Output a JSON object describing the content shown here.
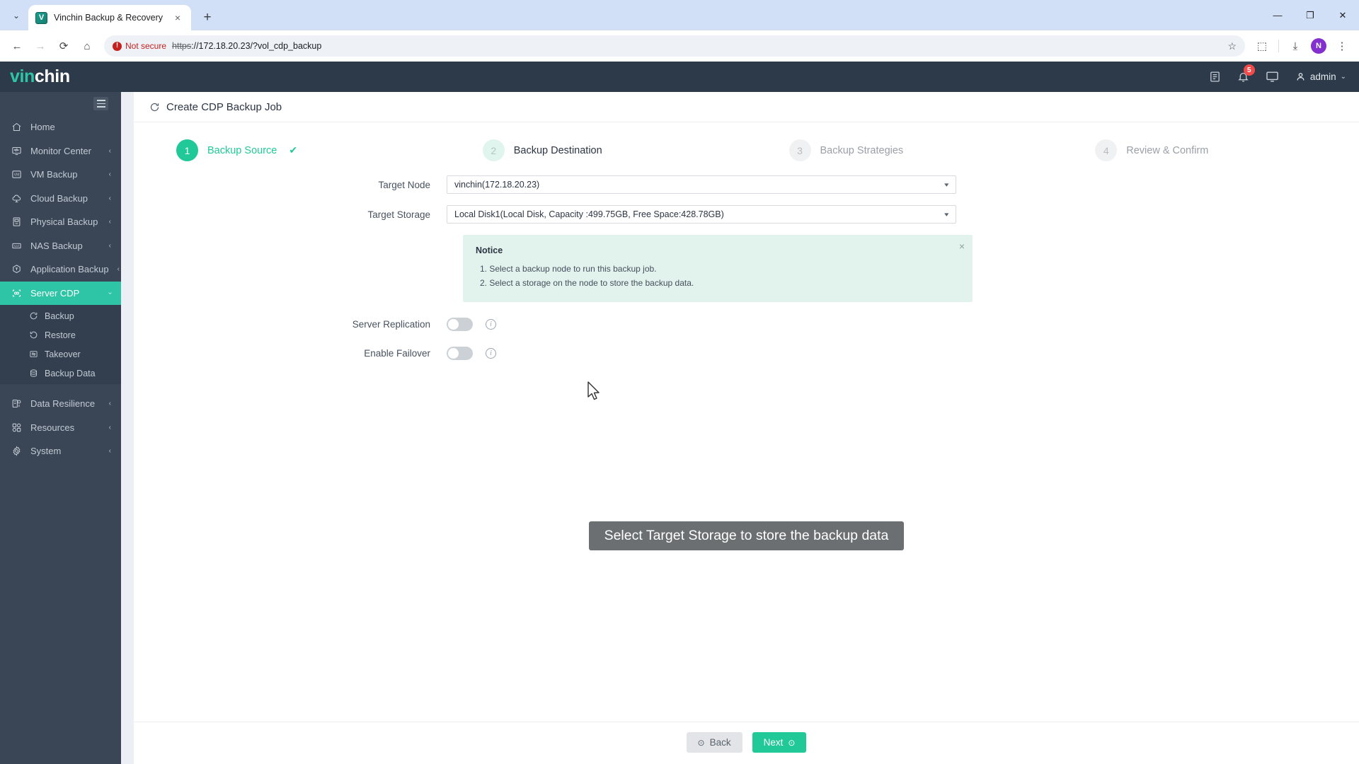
{
  "browser": {
    "tab": {
      "title": "Vinchin Backup & Recovery",
      "favicon_letter": "V",
      "close_label": "×"
    },
    "new_tab_label": "+",
    "tabstrip_caret": "⌄",
    "window_controls": {
      "minimize": "—",
      "maximize": "❐",
      "close": "✕"
    },
    "nav": {
      "back": "←",
      "forward": "→",
      "reload": "⟳",
      "home": "⌂"
    },
    "omnibox": {
      "security_label": "Not secure",
      "security_glyph": "!",
      "url_scheme": "https",
      "url_rest": "://172.18.20.23/?vol_cdp_backup",
      "star": "☆"
    },
    "toolbar_right": {
      "extensions": "⬚",
      "downloads": "⤓",
      "profile_letter": "N",
      "menu": "⋮"
    }
  },
  "app_header": {
    "logo_part1": "vin",
    "logo_part2": "chin",
    "notifications_count": "5",
    "user_name": "admin",
    "user_caret": "⌄"
  },
  "sidebar": {
    "items": [
      {
        "label": "Home",
        "icon": "home-icon",
        "expandable": false,
        "active": false
      },
      {
        "label": "Monitor Center",
        "icon": "monitor-icon",
        "expandable": true,
        "active": false
      },
      {
        "label": "VM Backup",
        "icon": "vm-icon",
        "expandable": true,
        "active": false
      },
      {
        "label": "Cloud Backup",
        "icon": "cloud-icon",
        "expandable": true,
        "active": false
      },
      {
        "label": "Physical Backup",
        "icon": "server-icon",
        "expandable": true,
        "active": false
      },
      {
        "label": "NAS Backup",
        "icon": "nas-icon",
        "expandable": true,
        "active": false
      },
      {
        "label": "Application Backup",
        "icon": "app-icon",
        "expandable": true,
        "active": false
      },
      {
        "label": "Server CDP",
        "icon": "cdp-icon",
        "expandable": true,
        "active": true
      }
    ],
    "submenu": [
      {
        "label": "Backup",
        "icon": "backup-refresh-icon"
      },
      {
        "label": "Restore",
        "icon": "restore-undo-icon"
      },
      {
        "label": "Takeover",
        "icon": "takeover-list-icon"
      },
      {
        "label": "Backup Data",
        "icon": "database-icon"
      }
    ],
    "bottom_items": [
      {
        "label": "Data Resilience",
        "icon": "resilience-icon",
        "expandable": true
      },
      {
        "label": "Resources",
        "icon": "grid-icon",
        "expandable": true
      },
      {
        "label": "System",
        "icon": "gear-icon",
        "expandable": true
      }
    ],
    "chevron": "‹"
  },
  "page": {
    "title": "Create CDP Backup Job",
    "refresh_icon": "⟳"
  },
  "stepper": {
    "steps": [
      {
        "num": "1",
        "label": "Backup Source",
        "state": "done",
        "check": "✔"
      },
      {
        "num": "2",
        "label": "Backup Destination",
        "state": "next",
        "check": ""
      },
      {
        "num": "3",
        "label": "Backup Strategies",
        "state": "todo",
        "check": ""
      },
      {
        "num": "4",
        "label": "Review & Confirm",
        "state": "todo",
        "check": ""
      }
    ]
  },
  "form": {
    "target_node": {
      "label": "Target Node",
      "value": "vinchin(172.18.20.23)"
    },
    "target_storage": {
      "label": "Target Storage",
      "value": "Local Disk1(Local Disk, Capacity :499.75GB, Free Space:428.78GB)"
    },
    "notice": {
      "title": "Notice",
      "lines": [
        "1. Select a backup node to run this backup job.",
        "2. Select a storage on the node to store the backup data."
      ],
      "close": "×"
    },
    "server_replication": {
      "label": "Server Replication",
      "enabled": false,
      "info": "i"
    },
    "enable_failover": {
      "label": "Enable Failover",
      "enabled": false,
      "info": "i"
    }
  },
  "tooltip": {
    "text": "Select Target Storage to store the backup data"
  },
  "footer": {
    "back": {
      "label": "Back",
      "icon": "⊙"
    },
    "next": {
      "label": "Next",
      "icon": "⊙"
    }
  },
  "colors": {
    "brand_teal": "#2ec4a6",
    "accent_green": "#20c997",
    "sidebar_bg": "#3a4656",
    "header_bg": "#2c3a49",
    "notice_bg": "#e2f2ec",
    "tooltip_bg": "#6b6f72",
    "danger": "#c5221f"
  }
}
